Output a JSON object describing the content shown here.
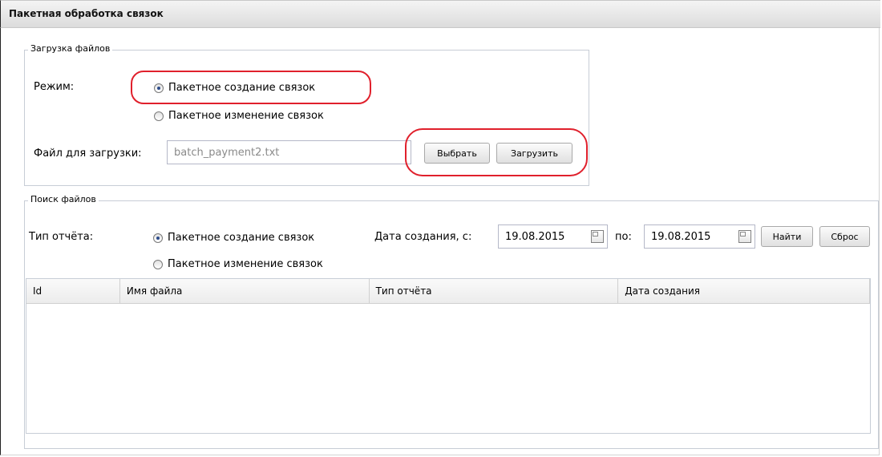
{
  "window": {
    "title": "Пакетная обработка связок"
  },
  "upload": {
    "legend": "Загрузка файлов",
    "mode_label": "Режим:",
    "mode_options": [
      {
        "label": "Пакетное создание связок",
        "selected": true
      },
      {
        "label": "Пакетное изменение связок",
        "selected": false
      }
    ],
    "file_label": "Файл для загрузки:",
    "file_value": "batch_payment2.txt",
    "choose_button": "Выбрать",
    "upload_button": "Загрузить"
  },
  "search": {
    "legend": "Поиск файлов",
    "report_type_label": "Тип отчёта:",
    "report_options": [
      {
        "label": "Пакетное создание связок",
        "selected": true
      },
      {
        "label": "Пакетное изменение связок",
        "selected": false
      }
    ],
    "date_from_label": "Дата создания, с:",
    "date_from": "19.08.2015",
    "date_to_label": "по:",
    "date_to": "19.08.2015",
    "find_button": "Найти",
    "reset_button": "Сброс"
  },
  "table": {
    "columns": [
      "Id",
      "Имя файла",
      "Тип отчёта",
      "Дата создания"
    ],
    "rows": []
  },
  "colors": {
    "highlight": "#e0202c"
  }
}
